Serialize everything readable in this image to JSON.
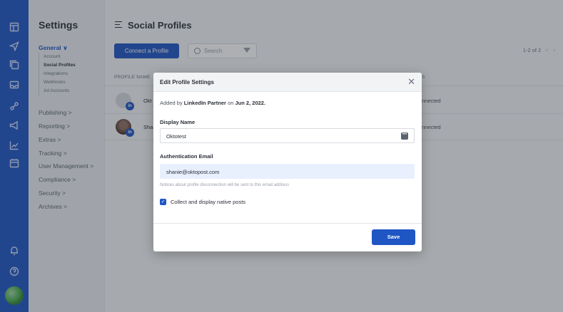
{
  "sidebar": {
    "title": "Settings",
    "general": "General ∨",
    "sub_items": [
      "Account",
      "Social Profiles",
      "Integrations",
      "Webhooks",
      "Ad Accounts"
    ],
    "sections": [
      "Publishing >",
      "Reporting >",
      "Extras >",
      "Tracking >",
      "User Management >",
      "Compliance >",
      "Security >",
      "Archives >"
    ]
  },
  "main": {
    "title": "Social Profiles",
    "connect_label": "Connect a Profile",
    "search_placeholder": "Search",
    "pager": "1-2 of 2",
    "col_profile": "PROFILE NAME",
    "rows": [
      {
        "name": "Okt",
        "status": "nnected"
      },
      {
        "name": "Sha",
        "status": "nnected"
      }
    ],
    "status_col_fragment": "S"
  },
  "modal": {
    "title": "Edit Profile Settings",
    "added_prefix": "Added by",
    "added_by": "LinkedIn Partner",
    "added_on": "on",
    "added_date": "Jun 2, 2022.",
    "display_name_label": "Display Name",
    "display_name_value": "Oktotest",
    "auth_email_label": "Authentication Email",
    "auth_email_value": "shanie@oktopost.com",
    "hint": "Notices about profile disconnection will be sent to this email address",
    "checkbox_label": "Collect and display native posts",
    "save_label": "Save"
  },
  "colors": {
    "brand": "#1f56c4",
    "email_bg": "#e8f0fe"
  },
  "icons": [
    "dashboard-icon",
    "send-icon",
    "content-icon",
    "inbox-icon",
    "social-icon",
    "campaign-icon",
    "analytics-icon",
    "calendar-icon",
    "bell-icon",
    "help-icon"
  ]
}
